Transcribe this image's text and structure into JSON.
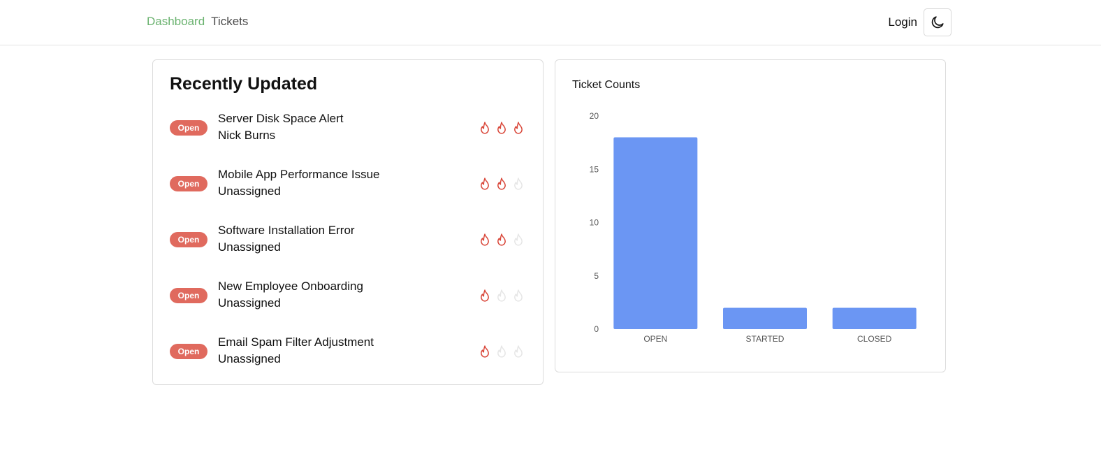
{
  "nav": {
    "dashboard": "Dashboard",
    "tickets": "Tickets",
    "login": "Login",
    "theme_icon": "moon-icon"
  },
  "recent": {
    "title": "Recently Updated",
    "tickets": [
      {
        "status": "Open",
        "title": "Server Disk Space Alert",
        "assignee": "Nick Burns",
        "priority": 3
      },
      {
        "status": "Open",
        "title": "Mobile App Performance Issue",
        "assignee": "Unassigned",
        "priority": 2
      },
      {
        "status": "Open",
        "title": "Software Installation Error",
        "assignee": "Unassigned",
        "priority": 2
      },
      {
        "status": "Open",
        "title": "New Employee Onboarding",
        "assignee": "Unassigned",
        "priority": 1
      },
      {
        "status": "Open",
        "title": "Email Spam Filter Adjustment",
        "assignee": "Unassigned",
        "priority": 1
      }
    ],
    "priority_max": 3,
    "priority_icon": "flame-icon"
  },
  "colors": {
    "accent": "#6ab26f",
    "badge": "#e06a5e",
    "flame_active": "#d9473a",
    "flame_inactive": "#e6e6e6",
    "bar": "#6b96f3"
  },
  "chart_title": "Ticket Counts",
  "chart_data": {
    "type": "bar",
    "title": "Ticket Counts",
    "categories": [
      "OPEN",
      "STARTED",
      "CLOSED"
    ],
    "values": [
      18,
      2,
      2
    ],
    "yticks": [
      0,
      5,
      10,
      15,
      20
    ],
    "ylim": [
      0,
      20
    ],
    "xlabel": "",
    "ylabel": "",
    "grid": false,
    "legend": "none"
  }
}
